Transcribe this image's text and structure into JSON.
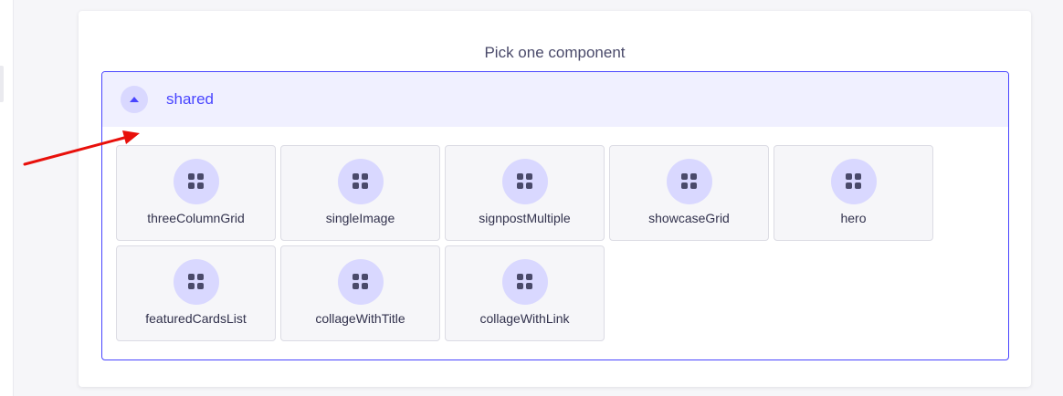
{
  "panel": {
    "heading": "Pick one component"
  },
  "category": {
    "name": "shared",
    "expanded": true,
    "toggle_icon": "chevron-up-icon",
    "components": [
      {
        "label": "threeColumnGrid",
        "icon": "grid-icon"
      },
      {
        "label": "singleImage",
        "icon": "grid-icon"
      },
      {
        "label": "signpostMultiple",
        "icon": "grid-icon"
      },
      {
        "label": "showcaseGrid",
        "icon": "grid-icon"
      },
      {
        "label": "hero",
        "icon": "grid-icon"
      },
      {
        "label": "featuredCardsList",
        "icon": "grid-icon"
      },
      {
        "label": "collageWithTitle",
        "icon": "grid-icon"
      },
      {
        "label": "collageWithLink",
        "icon": "grid-icon"
      }
    ]
  },
  "annotation": {
    "type": "arrow",
    "color": "#e8100b"
  },
  "colors": {
    "accent": "#4945ff",
    "accent_light": "#f0f0ff",
    "icon_bg": "#d9d8ff",
    "text": "#32324d"
  }
}
